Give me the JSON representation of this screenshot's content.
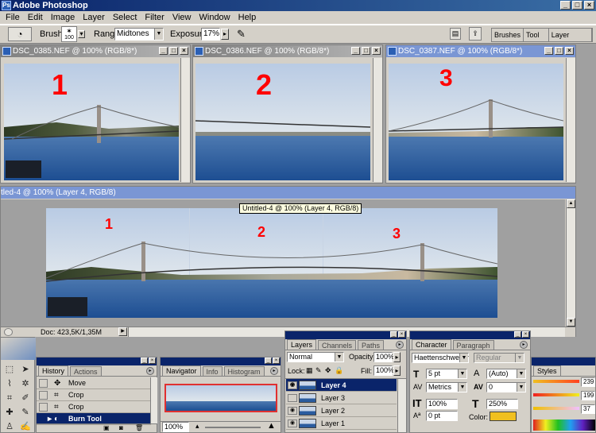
{
  "app": {
    "title": "Adobe Photoshop"
  },
  "menu": [
    "File",
    "Edit",
    "Image",
    "Layer",
    "Select",
    "Filter",
    "View",
    "Window",
    "Help"
  ],
  "options": {
    "brush_label": "Brush:",
    "brush_size": "100",
    "range_label": "Range:",
    "range_value": "Midtones",
    "exposure_label": "Exposure:",
    "exposure_value": "17%",
    "palette_tabs": [
      "Brushes",
      "Tool Pr",
      "Layer Comps"
    ]
  },
  "docs": [
    {
      "title": "DSC_0385.NEF @ 100% (RGB/8*)",
      "number": "1"
    },
    {
      "title": "DSC_0386.NEF @ 100% (RGB/8*)",
      "number": "2"
    },
    {
      "title": "DSC_0387.NEF @ 100% (RGB/8*)",
      "number": "3"
    }
  ],
  "panorama": {
    "title": "tled-4 @ 100% (Layer 4, RGB/8)",
    "tooltip": "Untitled-4 @ 100% (Layer 4, RGB/8)",
    "numbers": [
      "1",
      "2",
      "3"
    ],
    "status": "Doc: 423,5K/1,35M"
  },
  "history": {
    "tabs": [
      "History",
      "Actions"
    ],
    "items": [
      "Move",
      "Crop",
      "Crop",
      "Burn Tool"
    ]
  },
  "navigator": {
    "tabs": [
      "Navigator",
      "Info",
      "Histogram"
    ],
    "zoom": "100%"
  },
  "layers": {
    "tabs": [
      "Layers",
      "Channels",
      "Paths"
    ],
    "blend": "Normal",
    "opacity_label": "Opacity:",
    "opacity": "100%",
    "lock_label": "Lock:",
    "fill_label": "Fill:",
    "fill": "100%",
    "items": [
      "Layer 4",
      "Layer 3",
      "Layer 2",
      "Layer 1"
    ]
  },
  "character": {
    "tabs": [
      "Character",
      "Paragraph"
    ],
    "font": "Haettenschweiler",
    "style": "Regular",
    "size": "5 pt",
    "leading": "(Auto)",
    "kerning": "Metrics",
    "tracking": "0",
    "vscale": "100%",
    "hscale": "250%",
    "baseline": "0 pt",
    "color_label": "Color:",
    "color": "#f0c020"
  },
  "styles": {
    "tab": "Styles",
    "values": [
      "239",
      "199",
      "37"
    ]
  }
}
